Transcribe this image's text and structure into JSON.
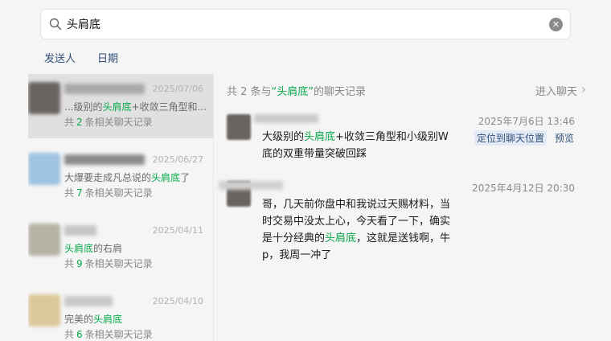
{
  "search": {
    "value": "头肩底",
    "placeholder": ""
  },
  "filters": [
    "发送人",
    "日期"
  ],
  "conversations": [
    {
      "date": "2025/07/06",
      "snippet_pre": "...级别的",
      "keyword": "头肩底",
      "snippet_post": "+收敛三角型和...",
      "count_pre": "共",
      "count": "2",
      "count_post": "条相关聊天记录",
      "avatar_color": "#6a6460",
      "name_color": "#a9a9a9"
    },
    {
      "date": "2025/06/27",
      "snippet_pre": "大爆要走成凡总说的",
      "keyword": "头肩底",
      "snippet_post": "了",
      "count_pre": "共",
      "count": "7",
      "count_post": "条相关聊天记录",
      "avatar_color": "#9fc3e0",
      "name_color": "#8b8b8b"
    },
    {
      "date": "2025/04/11",
      "snippet_pre": "",
      "keyword": "头肩底",
      "snippet_post": "的右肩",
      "count_pre": "共",
      "count": "9",
      "count_post": "条相关聊天记录",
      "avatar_color": "#b6b2a6",
      "name_color": "#c4c4c4"
    },
    {
      "date": "2025/04/10",
      "snippet_pre": "完美的",
      "keyword": "头肩底",
      "snippet_post": "",
      "count_pre": "共",
      "count": "6",
      "count_post": "条相关聊天记录",
      "avatar_color": "#dcc79a",
      "name_color": "#c8c8c8"
    }
  ],
  "results_header": {
    "pre": "共 2 条与",
    "keyword": "“头肩底”",
    "post": "的聊天记录"
  },
  "enter_chat": "进入聊天",
  "messages": [
    {
      "time": "2025年7月6日 13:46",
      "lines": [
        {
          "pre": "大级别的",
          "kw": "头肩底",
          "post": "+收敛三角型和小级别W"
        },
        {
          "pre": "底的双重带量突破回踩",
          "kw": "",
          "post": ""
        }
      ],
      "locate": "定位到聊天位置",
      "preview": "预览"
    },
    {
      "time": "2025年4月12日 20:30",
      "lines": [
        {
          "pre": "哥，几天前你盘中和我说过天赐材料，当",
          "kw": "",
          "post": ""
        },
        {
          "pre": "时交易中没太上心，今天看了一下，确实",
          "kw": "",
          "post": ""
        },
        {
          "pre": "是十分经典的",
          "kw": "头肩底",
          "post": "，这就是送钱啊，牛"
        },
        {
          "pre": "p，我周一冲了",
          "kw": "",
          "post": ""
        }
      ]
    }
  ],
  "colors": {
    "keyword": "#07a94a",
    "link": "#30507a",
    "selected_bg": "#e0e0e0"
  },
  "icons": {
    "search": "search-icon",
    "clear": "clear-icon",
    "chevron": "chevron-right-icon"
  }
}
